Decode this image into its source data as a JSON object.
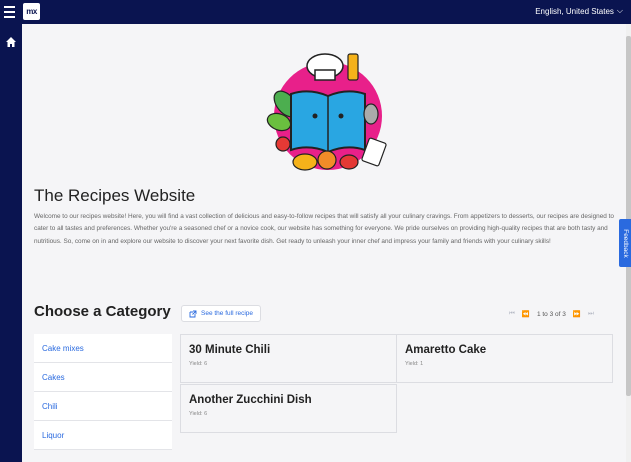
{
  "header": {
    "logo_text": "mx",
    "language": "English, United States",
    "language_caret": "⌵"
  },
  "hero": {
    "title": "The Recipes Website",
    "intro": "Welcome to our recipes website! Here, you will find a vast collection of delicious and easy-to-follow recipes that will satisfy all your culinary cravings. From appetizers to desserts, our recipes are designed to cater to all tastes and preferences. Whether you're a seasoned chef or a novice cook, our website has something for everyone. We pride ourselves on providing high-quality recipes that are both tasty and nutritious. So, come on in and explore our website to discover your next favorite dish. Get ready to unleash your inner chef and impress your family and friends with your culinary skills!"
  },
  "categories": {
    "title": "Choose a Category",
    "see_full_recipe": "See the full recipe",
    "items": [
      "Cake mixes",
      "Cakes",
      "Chili",
      "Liquor"
    ]
  },
  "pager": {
    "first": "⏮",
    "prev": "⏪",
    "text": "1 to 3 of 3",
    "next": "⏩",
    "last": "⏭"
  },
  "recipes": [
    {
      "name": "30 Minute Chili",
      "yield": "Yield: 6"
    },
    {
      "name": "Amaretto Cake",
      "yield": "Yield: 1"
    },
    {
      "name": "Another Zucchini Dish",
      "yield": "Yield: 6"
    }
  ],
  "feedback": "Feedback",
  "colors": {
    "nav": "#0a1450",
    "accent": "#2a6adf",
    "page_bg": "#f5f5f7"
  }
}
